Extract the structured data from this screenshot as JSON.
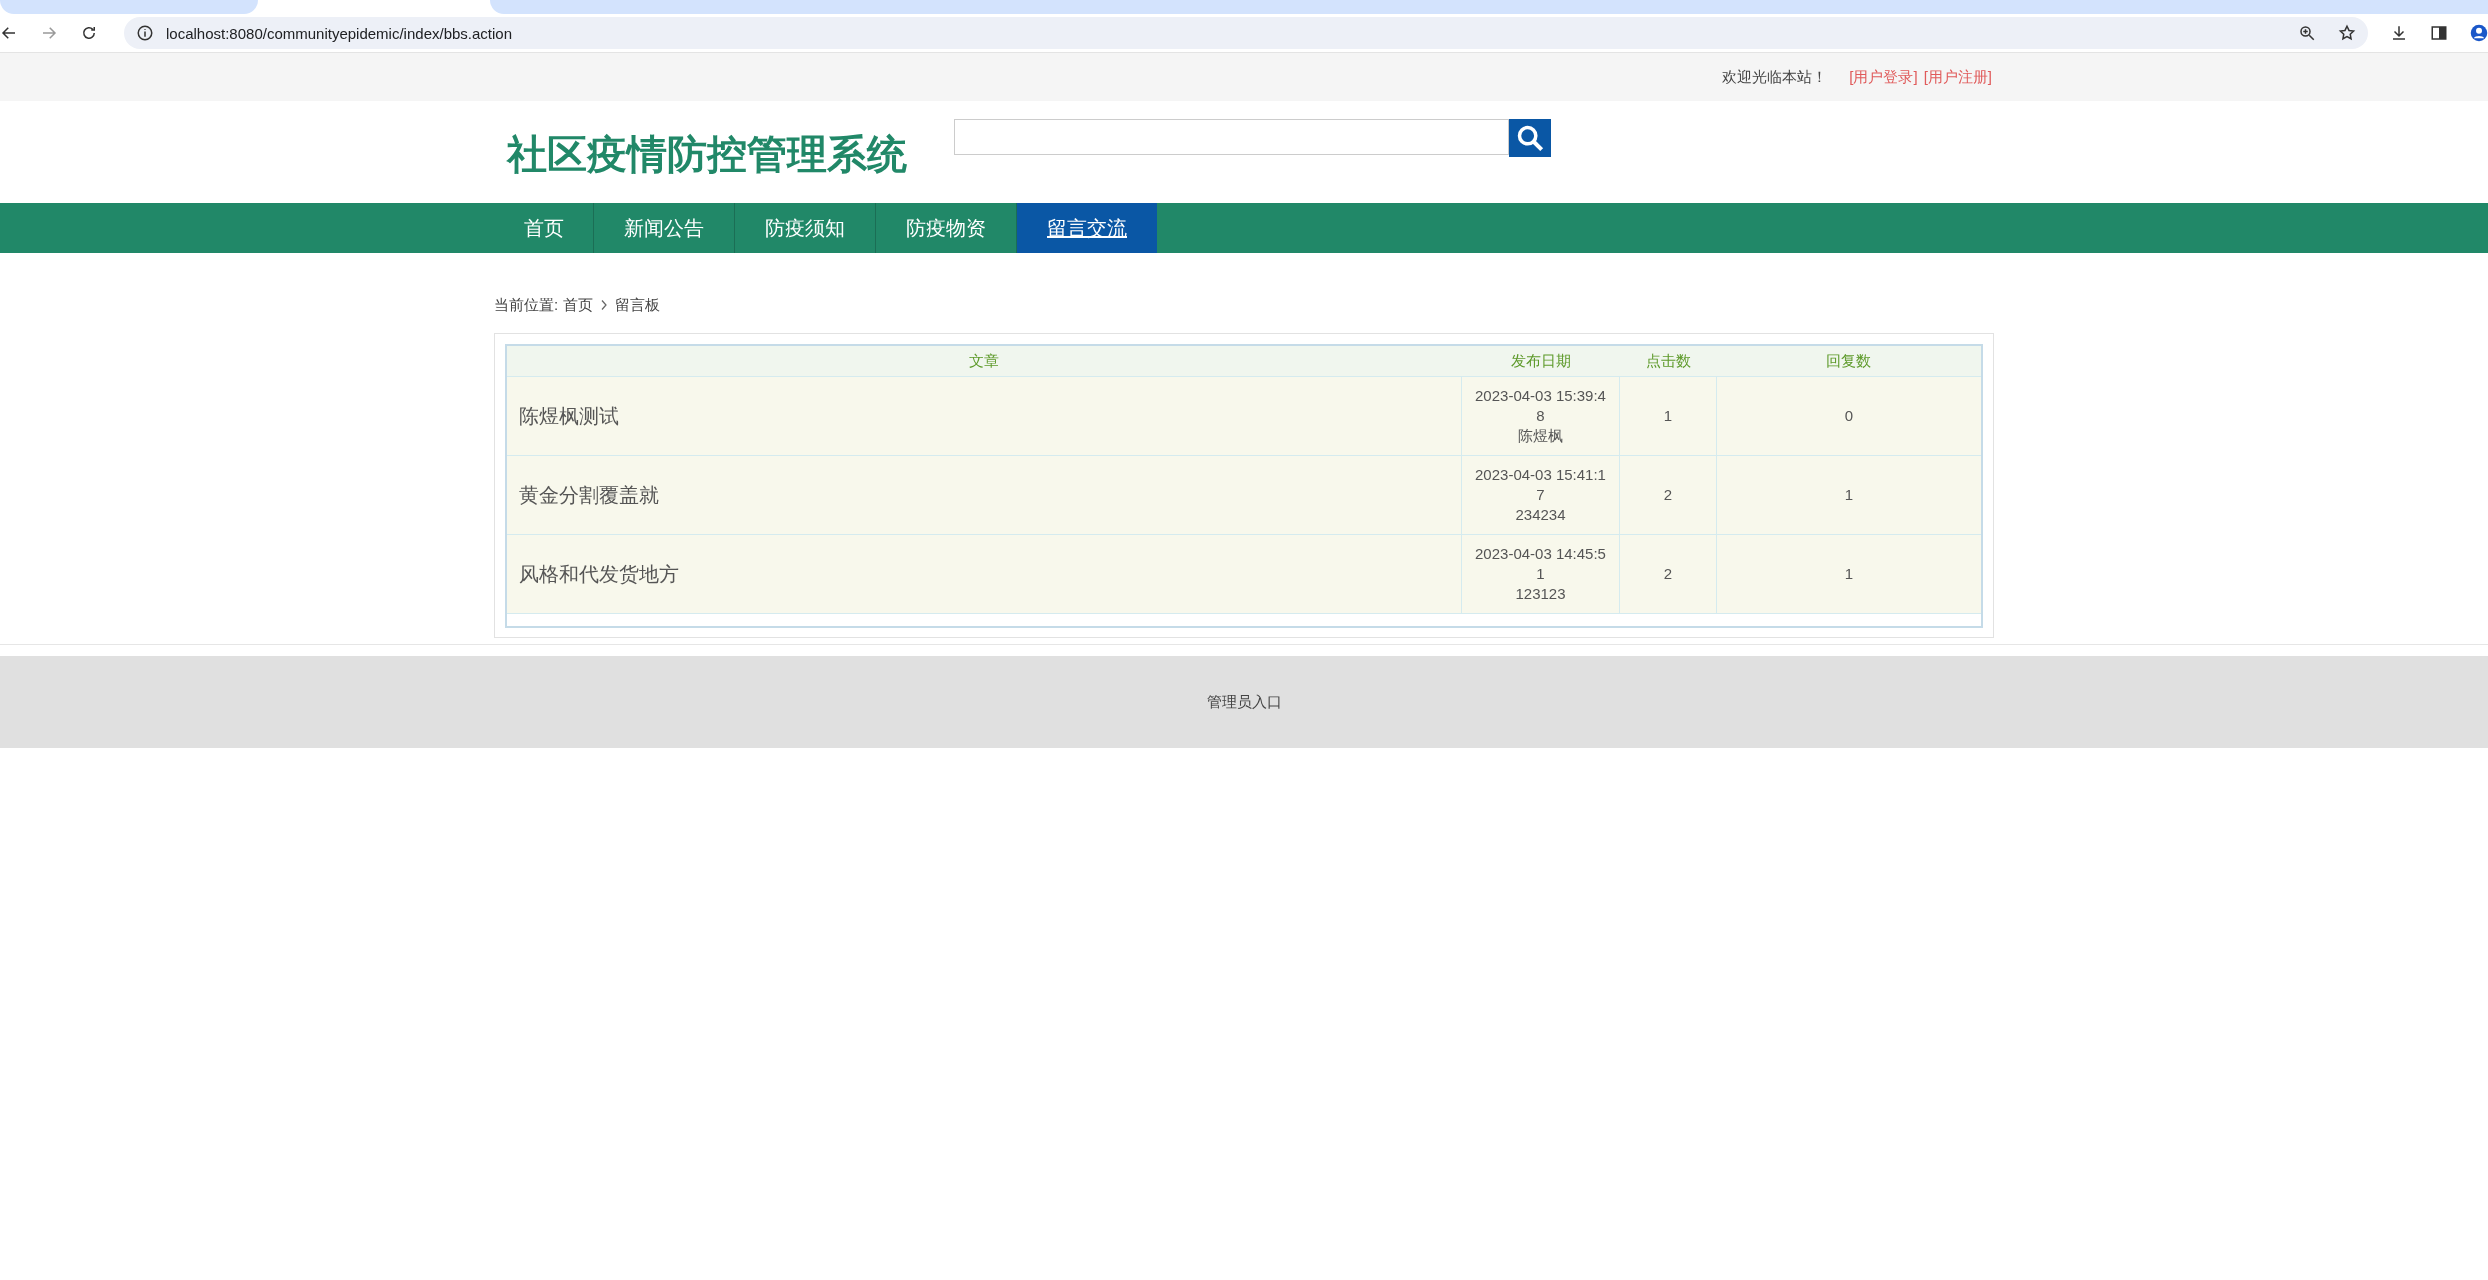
{
  "browser": {
    "url": "localhost:8080/communityepidemic/index/bbs.action"
  },
  "top_bar": {
    "welcome": "欢迎光临本站！",
    "links": [
      "[用户登录]",
      "[用户注册]"
    ]
  },
  "header": {
    "site_title": "社区疫情防控管理系统"
  },
  "nav": [
    {
      "label": "首页",
      "selected": false
    },
    {
      "label": "新闻公告",
      "selected": false
    },
    {
      "label": "防疫须知",
      "selected": false
    },
    {
      "label": "防疫物资",
      "selected": false
    },
    {
      "label": "留言交流",
      "selected": true
    }
  ],
  "breadcrumb": {
    "label": "当前位置:",
    "items": [
      "首页",
      "留言板"
    ]
  },
  "table": {
    "columns": [
      "文章",
      "发布日期",
      "点击数",
      "回复数"
    ],
    "rows": [
      {
        "title": "陈煜枫测试",
        "date": "2023-04-03 15:39:48",
        "author": "陈煜枫",
        "clicks": "1",
        "replies": "0"
      },
      {
        "title": "黄金分割覆盖就",
        "date": "2023-04-03 15:41:17",
        "author": "234234",
        "clicks": "2",
        "replies": "1"
      },
      {
        "title": "风格和代发货地方",
        "date": "2023-04-03 14:45:51",
        "author": "123123",
        "clicks": "2",
        "replies": "1"
      }
    ]
  },
  "footer": {
    "admin_link": "管理员入口"
  }
}
